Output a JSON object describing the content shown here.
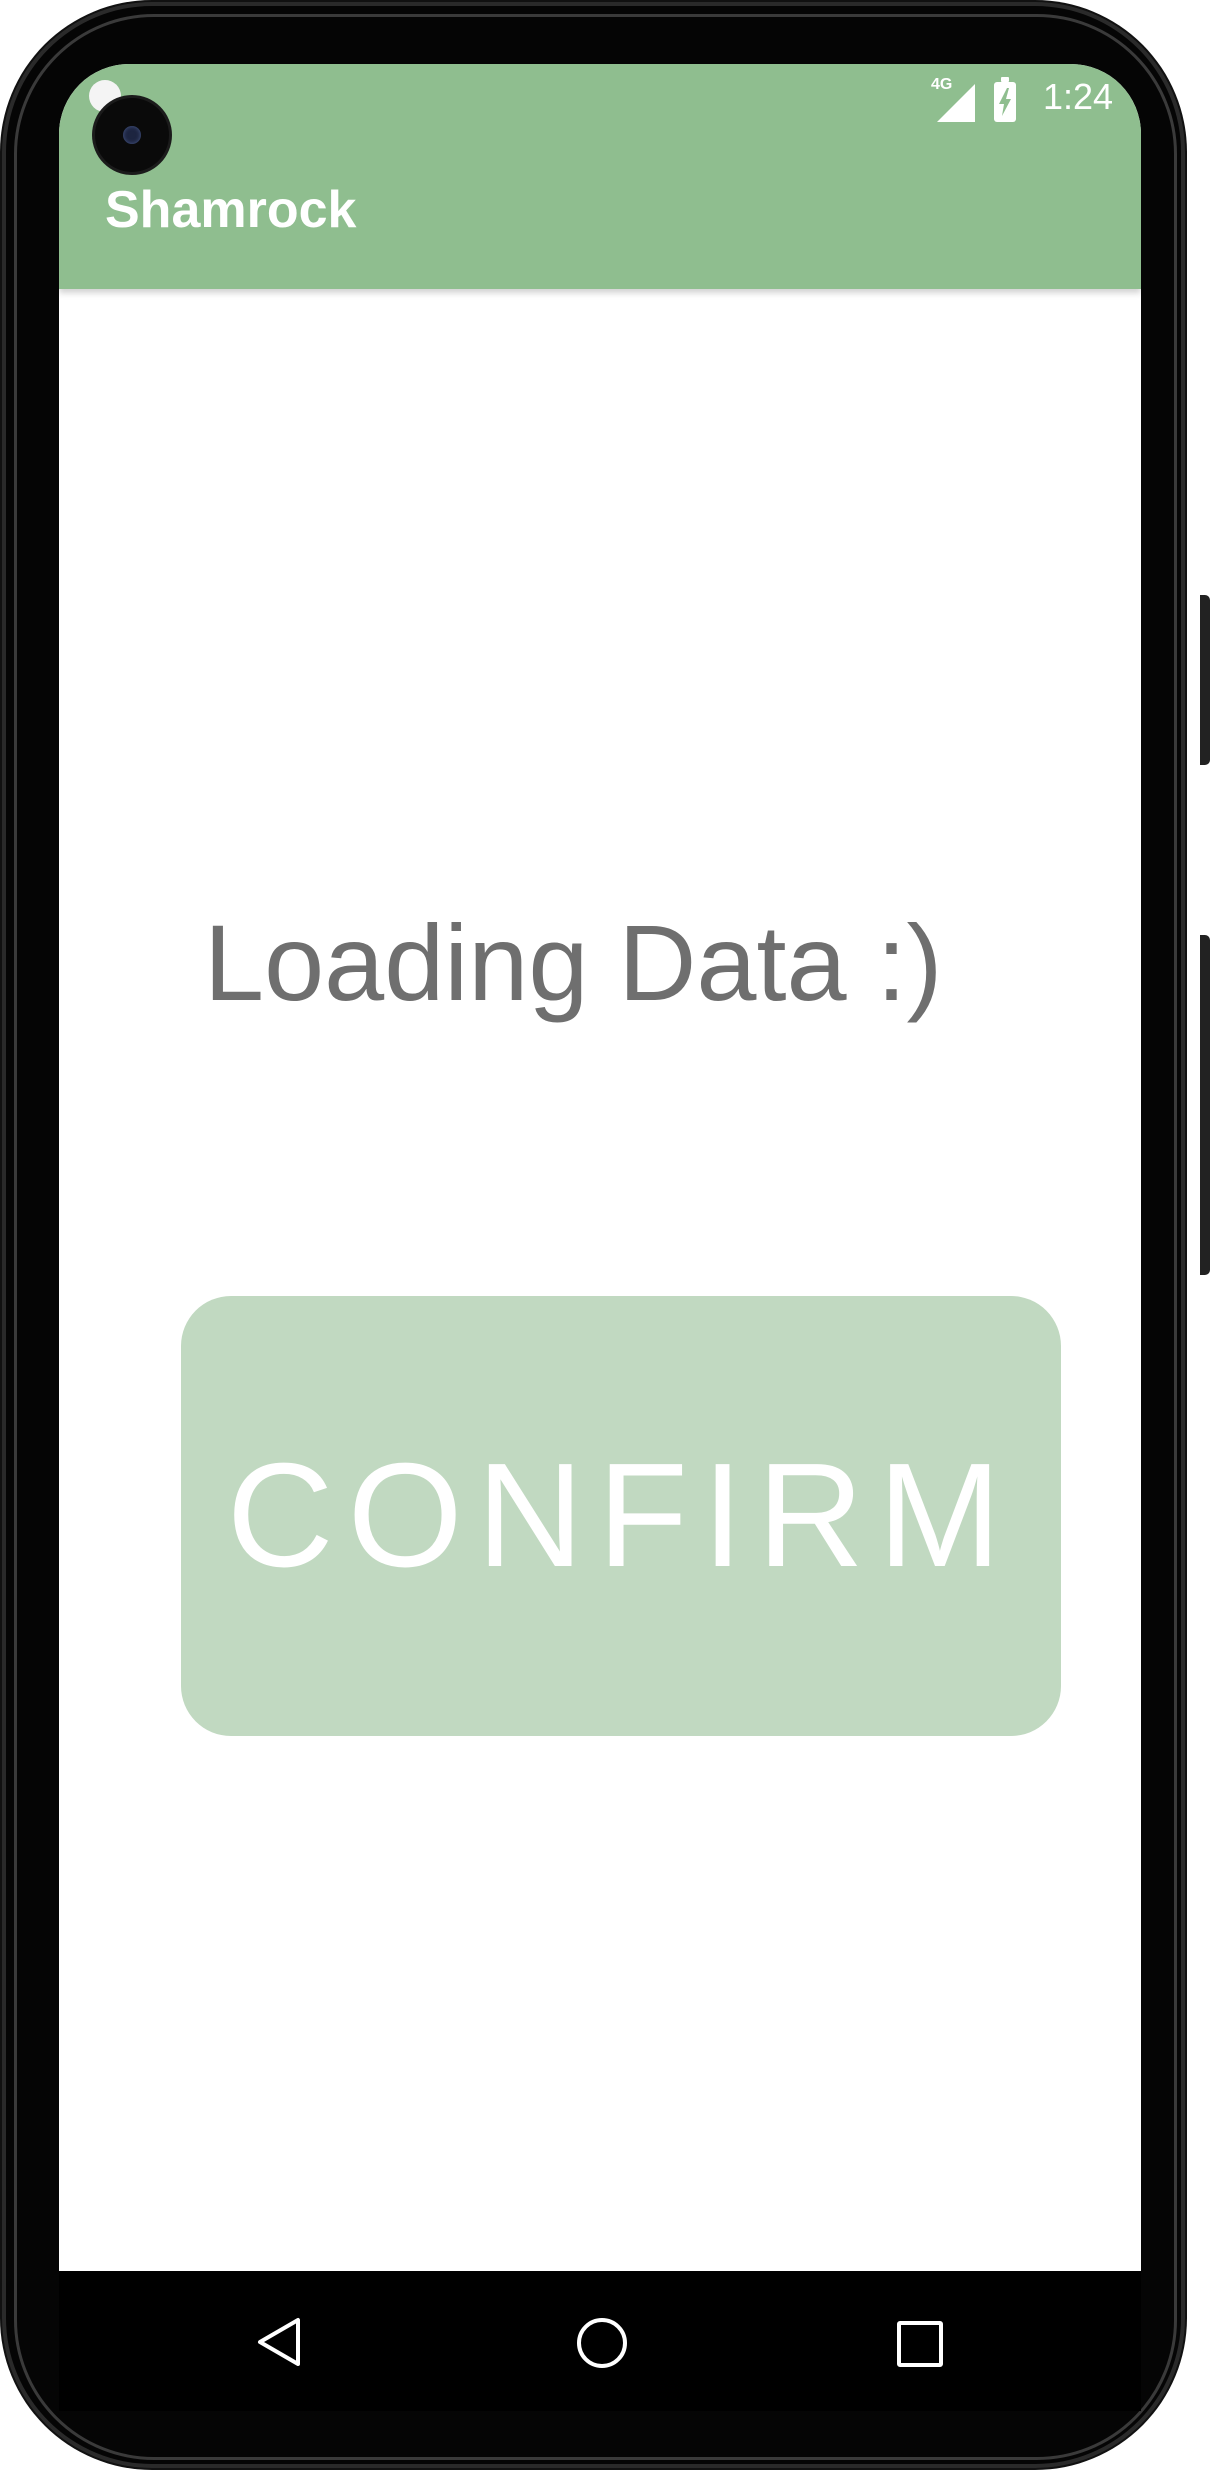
{
  "status_bar": {
    "network_label": "4G",
    "time": "1:24",
    "icons": [
      "notification-icon",
      "cellular-signal-icon",
      "battery-charging-icon"
    ]
  },
  "app_bar": {
    "title": "Shamrock",
    "color": "#8fbe8f"
  },
  "main": {
    "loading_text": "Loading Data :)",
    "confirm_button": {
      "label": "CONFIRM",
      "background": "#c1d9c1",
      "text_color": "#ffffff"
    }
  },
  "nav_bar": {
    "icons": [
      "back-icon",
      "home-icon",
      "recents-icon"
    ]
  }
}
